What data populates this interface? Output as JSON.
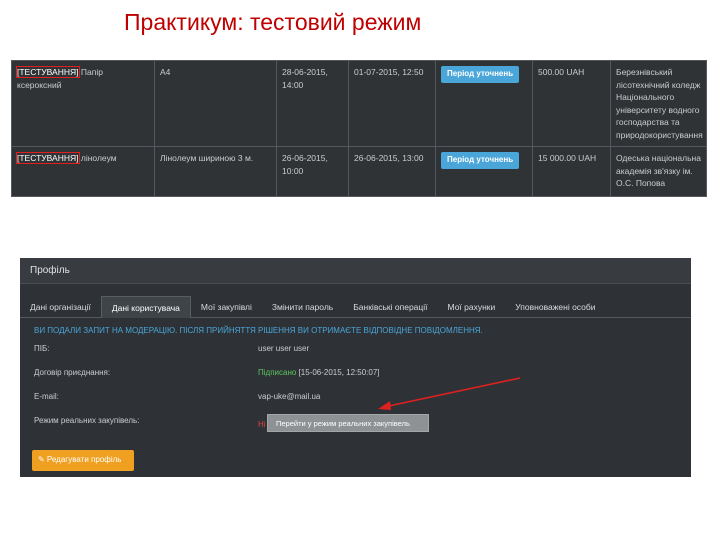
{
  "slide": {
    "title": "Практикум: тестовий режим"
  },
  "tenders": [
    {
      "test_tag": "[ТЕСТУВАННЯ]",
      "name": "Папір ксероксний",
      "item": "А4",
      "start": "28-06-2015, 14:00",
      "end": "01-07-2015, 12:50",
      "status": "Період уточнень",
      "amount": "500.00 UAH",
      "org": "Березнівський лісотехнічний коледж Національного університету водного господарства та природокористування"
    },
    {
      "test_tag": "[ТЕСТУВАННЯ]",
      "name": "лінолеум",
      "item": "Лінолеум шириною 3 м.",
      "start": "26-06-2015, 10:00",
      "end": "26-06-2015, 13:00",
      "status": "Період уточнень",
      "amount": "15 000.00 UAH",
      "org": "Одеська національна академія зв'язку ім. О.С. Попова"
    }
  ],
  "profile": {
    "header": "Профіль",
    "tabs": [
      "Дані організації",
      "Дані користувача",
      "Мої закупівлі",
      "Змінити пароль",
      "Банківські операції",
      "Мої рахунки",
      "Уповноважені особи"
    ],
    "notice": "ВИ ПОДАЛИ ЗАПИТ НА МОДЕРАЦІЮ. ПІСЛЯ ПРИЙНЯТТЯ РІШЕННЯ ВИ ОТРИМАЄТЕ ВІДПОВІДНЕ ПОВІДОМЛЕННЯ.",
    "fields": {
      "name_label": "ПІБ:",
      "name_value": "user user user",
      "contract_label": "Договір приєднання:",
      "contract_value": "Підписано",
      "contract_date": "[15-06-2015, 12:50:07]",
      "email_label": "E-mail:",
      "email_value": "vap-uke@mail.ua",
      "mode_label": "Режим реальних закупівель:",
      "mode_value": "Ні"
    },
    "switch_button": "Перейти у режим реальних закупівель",
    "edit_button": "✎ Редагувати профіль"
  },
  "colors": {
    "title": "#c00000",
    "panel_bg": "#2e3236",
    "badge": "#4aa6d9",
    "notice": "#4aa6d9",
    "signed": "#5cc45c",
    "no": "#e04040",
    "edit_button": "#f0a020",
    "highlight": "#e02020"
  }
}
